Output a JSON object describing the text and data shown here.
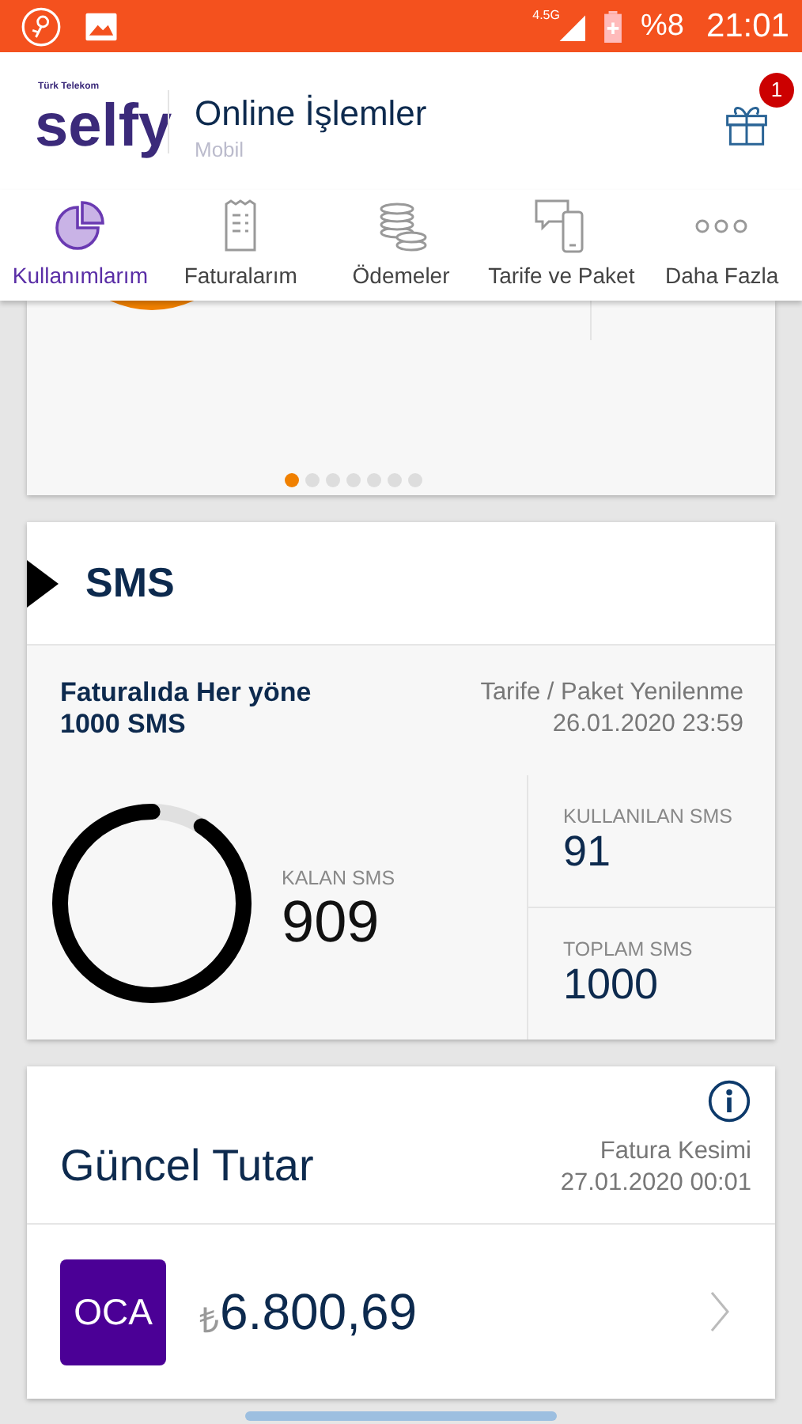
{
  "status_bar": {
    "network": "4.5G",
    "battery": "%8",
    "time": "21:01"
  },
  "header": {
    "brand_small": "Türk Telekom",
    "brand": "selfy",
    "title": "Online İşlemler",
    "subtitle": "Mobil",
    "gift_badge": "1"
  },
  "tabs": [
    {
      "label": "Kullanımlarım",
      "selected": true
    },
    {
      "label": "Faturalarım",
      "selected": false
    },
    {
      "label": "Ödemeler",
      "selected": false
    },
    {
      "label": "Tarife ve Paket",
      "selected": false
    },
    {
      "label": "Daha Fazla",
      "selected": false
    }
  ],
  "carousel": {
    "pages": [
      {
        "selected": true
      },
      {
        "selected": false
      },
      {
        "selected": false
      },
      {
        "selected": false
      },
      {
        "selected": false
      },
      {
        "selected": false
      },
      {
        "selected": false
      }
    ]
  },
  "sms": {
    "title": "SMS",
    "package": "Faturalıda Her yöne 1000 SMS",
    "renewal_label": "Tarife / Paket Yenilenme",
    "renewal_date": "26.01.2020 23:59",
    "remaining_label": "KALAN SMS",
    "remaining": "909",
    "level": 0.909,
    "used_label": "KULLANILAN SMS",
    "used": "91",
    "total_label": "TOPLAM SMS",
    "total": "1000"
  },
  "bill": {
    "title": "Güncel Tutar",
    "cut_label": "Fatura Kesimi",
    "cut_date": "27.01.2020 00:01",
    "month": "OCA",
    "currency": "₺",
    "amount": "6.800,69"
  }
}
